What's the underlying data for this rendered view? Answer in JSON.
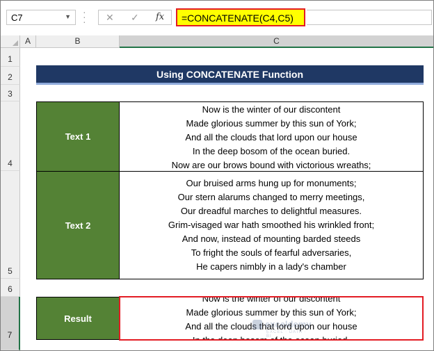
{
  "formula_bar": {
    "name_box": "C7",
    "cancel_icon": "✕",
    "enter_icon": "✓",
    "fx_label": "fx",
    "formula": "=CONCATENATE(C4,C5)"
  },
  "columns": [
    "A",
    "B",
    "C"
  ],
  "rows": [
    "1",
    "2",
    "3",
    "4",
    "5",
    "6",
    "7"
  ],
  "title": "Using CONCATENATE Function",
  "text1": {
    "label": "Text 1",
    "lines": [
      "Now is the winter of our discontent",
      "Made glorious summer by this sun of York;",
      "And all the clouds that lord upon our house",
      "In the deep bosom of the ocean buried.",
      "Now are our brows bound with victorious wreaths;"
    ]
  },
  "text2": {
    "label": "Text 2",
    "lines": [
      "Our bruised arms hung up for monuments;",
      "Our stern alarums changed to merry meetings,",
      "Our dreadful marches to delightful measures.",
      "Grim-visaged war hath smoothed his wrinkled front;",
      "And now, instead of mounting barded steeds",
      "To fright the souls of fearful adversaries,",
      "He capers nimbly in a lady's chamber"
    ]
  },
  "result": {
    "label": "Result",
    "lines": [
      "Now is the winter of our discontent",
      "Made glorious summer by this sun of York;",
      "And all the clouds that lord upon our house",
      "In the deep bosom of the ocean buried."
    ]
  },
  "watermark": {
    "name": "exceldemy",
    "sub": "EXCEL · DATA · BI"
  },
  "colors": {
    "banner": "#1f3864",
    "label_green": "#548235",
    "highlight": "#ffff00",
    "red_frame": "#e31b23"
  }
}
